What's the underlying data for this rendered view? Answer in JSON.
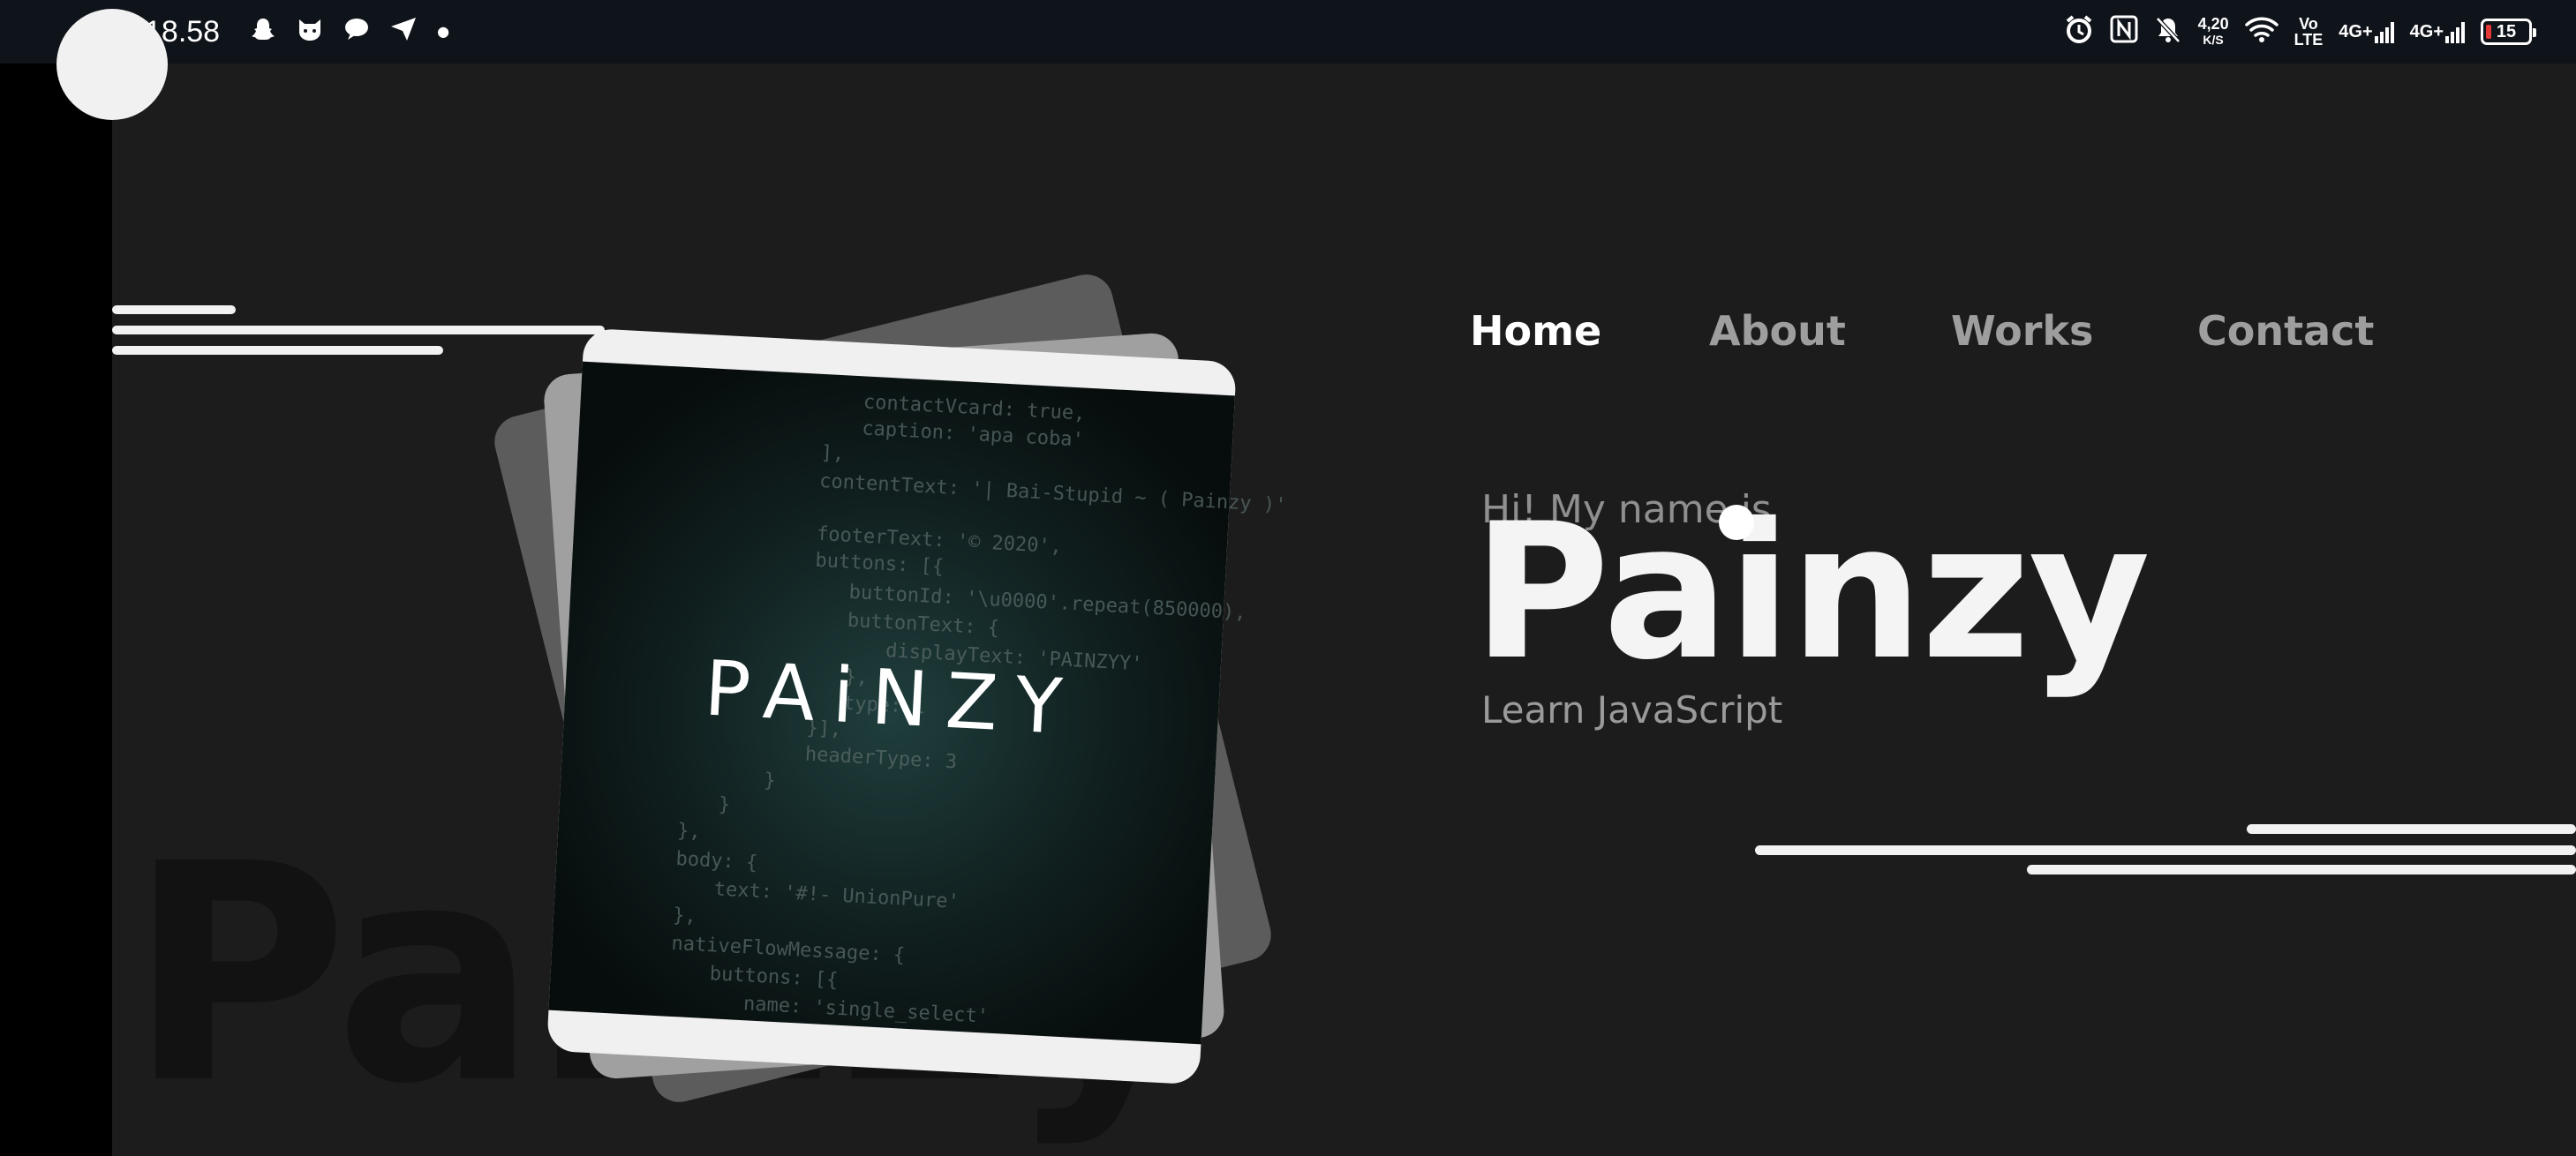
{
  "status_bar": {
    "time": "18.58",
    "net_speed_value": "4,20",
    "net_speed_unit": "K/S",
    "volte_top": "Vo",
    "volte_bottom": "LTE",
    "sim1": "4G+",
    "sim2": "4G+",
    "battery": "15",
    "left_icons": [
      "snapchat-icon",
      "cat-app-icon",
      "chat-bubble-icon",
      "send-icon",
      "notification-dot-icon"
    ],
    "right_icons": [
      "alarm-icon",
      "nfc-icon",
      "mute-icon",
      "wifi-icon",
      "signal-icon",
      "battery-icon"
    ]
  },
  "nav": {
    "items": [
      {
        "label": "Home",
        "active": true
      },
      {
        "label": "About",
        "active": false
      },
      {
        "label": "Works",
        "active": false
      },
      {
        "label": "Contact",
        "active": false
      }
    ]
  },
  "hero": {
    "greeting": "Hi! My name is",
    "name": "Painzy",
    "subtitle": "Learn JavaScript",
    "background_word": "Painzy"
  },
  "card_image": {
    "logo_text": "PAiNZY",
    "code_lines": [
      "contactVcard: true,",
      "caption: 'apa coba'",
      "],",
      "contentText: '| Bai-Stupid ~ ( Painzy )'",
      "footerText: '© 2020',",
      "buttons: [{",
      "buttonId: '\\u0000'.repeat(850000),",
      "buttonText: {",
      "displayText: 'PAINZYY'",
      "},",
      "type: 1",
      "}],",
      "headerType: 3",
      "}",
      "}",
      "},",
      "body: {",
      "text: '#!- UnionPure'",
      "},",
      "nativeFlowMessage: {",
      "buttons: [{",
      "name: 'single_select'"
    ]
  },
  "colors": {
    "background": "#1c1c1c",
    "status_bar": "#0f131a",
    "accent_white": "#f2f2f2",
    "nav_inactive": "#9e9e9e",
    "screen_dark": "#0e1617",
    "screen_glow": "#1e3a3a"
  }
}
